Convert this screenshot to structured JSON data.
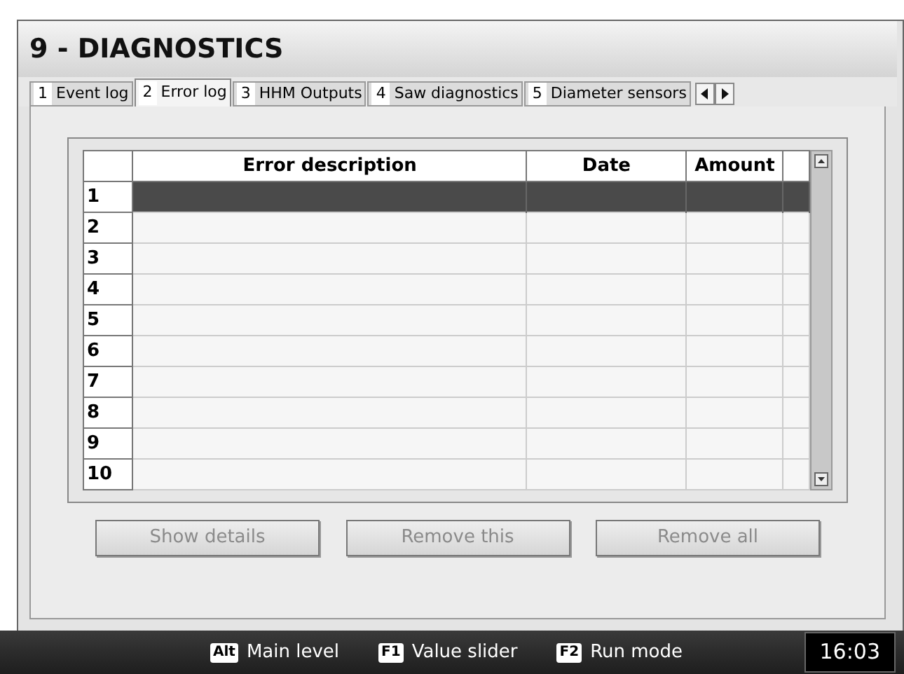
{
  "window": {
    "title": "9 - DIAGNOSTICS"
  },
  "tabs": [
    {
      "number": "1",
      "label": "Event log",
      "selected": false
    },
    {
      "number": "2",
      "label": "Error log",
      "selected": true
    },
    {
      "number": "3",
      "label": "HHM Outputs",
      "selected": false
    },
    {
      "number": "4",
      "label": "Saw diagnostics",
      "selected": false
    },
    {
      "number": "5",
      "label": "Diameter sensors",
      "selected": false
    }
  ],
  "table": {
    "columns": [
      "Error description",
      "Date",
      "Amount"
    ],
    "rows": [
      {
        "number": "1",
        "selected": true
      },
      {
        "number": "2",
        "selected": false
      },
      {
        "number": "3",
        "selected": false
      },
      {
        "number": "4",
        "selected": false
      },
      {
        "number": "5",
        "selected": false
      },
      {
        "number": "6",
        "selected": false
      },
      {
        "number": "7",
        "selected": false
      },
      {
        "number": "8",
        "selected": false
      },
      {
        "number": "9",
        "selected": false
      },
      {
        "number": "10",
        "selected": false
      }
    ]
  },
  "buttons": [
    {
      "label": "Show details",
      "disabled": true
    },
    {
      "label": "Remove this",
      "disabled": true
    },
    {
      "label": "Remove all",
      "disabled": true
    }
  ],
  "status_bar": {
    "shortcuts": [
      {
        "key": "Alt",
        "label": "Main level"
      },
      {
        "key": "F1",
        "label": "Value slider"
      },
      {
        "key": "F2",
        "label": "Run mode"
      }
    ],
    "time": "16:03"
  }
}
